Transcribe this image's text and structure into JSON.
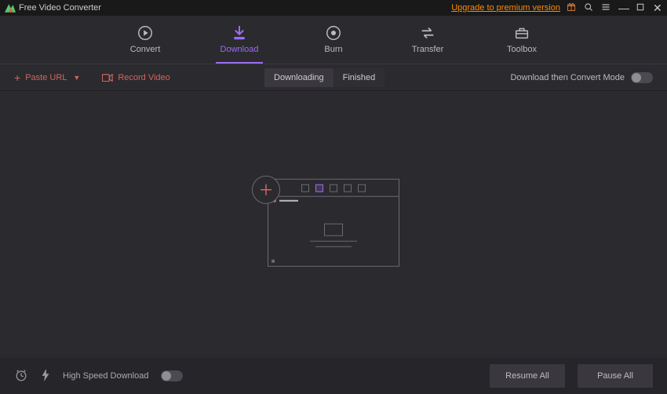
{
  "titlebar": {
    "app_name": "Free Video Converter",
    "premium_link": "Upgrade to premium version"
  },
  "nav": {
    "convert": "Convert",
    "download": "Download",
    "burn": "Burn",
    "transfer": "Transfer",
    "toolbox": "Toolbox"
  },
  "toolbar": {
    "paste_url": "Paste URL",
    "record_video": "Record Video",
    "tab_downloading": "Downloading",
    "tab_finished": "Finished",
    "mode_label": "Download then Convert Mode"
  },
  "footer": {
    "high_speed": "High Speed Download",
    "resume_all": "Resume All",
    "pause_all": "Pause All"
  }
}
